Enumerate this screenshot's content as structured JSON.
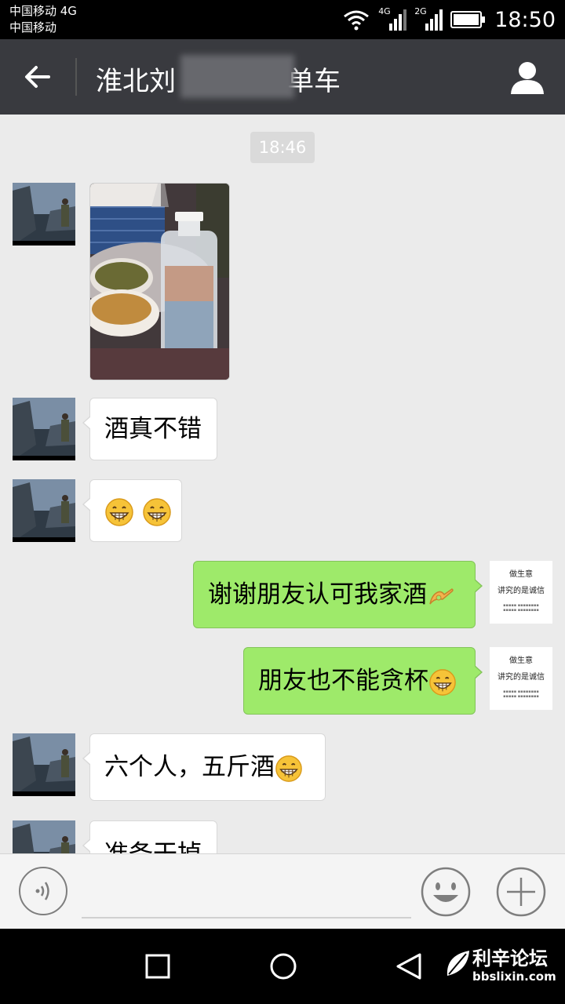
{
  "status_bar": {
    "carrier_1": "中国移动 4G",
    "carrier_2": "中国移动",
    "net_1": "4G",
    "net_2": "2G",
    "time": "18:50"
  },
  "header": {
    "title": "淮北刘",
    "title_tail": "单车"
  },
  "chat": {
    "timestamp": "18:46",
    "messages": [
      {
        "side": "in",
        "type": "image"
      },
      {
        "side": "in",
        "type": "text",
        "text": "酒真不错"
      },
      {
        "side": "in",
        "type": "emoji"
      },
      {
        "side": "out",
        "type": "text",
        "text": "谢谢朋友认可我家酒"
      },
      {
        "side": "out",
        "type": "text",
        "text": "朋友也不能贪杯"
      },
      {
        "side": "in",
        "type": "text",
        "text": "六个人，五斤酒"
      },
      {
        "side": "in",
        "type": "text",
        "text": "准备干掉"
      }
    ]
  },
  "my_avatar": {
    "line_1": "做生意",
    "line_2": "讲究的是诚信"
  },
  "watermark": {
    "name": "利辛论坛",
    "url": "bbslixin.com"
  },
  "icons": [
    "back-arrow-icon",
    "profile-icon",
    "voice-icon",
    "emoji-icon",
    "plus-icon",
    "grin-emoji-icon",
    "ok-hand-icon"
  ],
  "colors": {
    "title_bar": "#393a3f",
    "chat_bg": "#ebebeb",
    "out_bubble": "#9eea6a",
    "in_bubble": "#ffffff"
  }
}
